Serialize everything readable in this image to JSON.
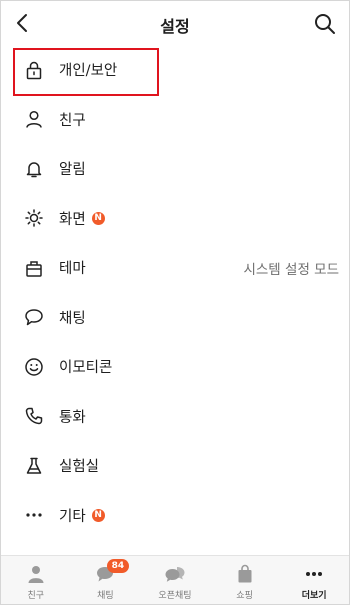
{
  "header": {
    "title": "설정",
    "back_icon": "chevron-left-icon",
    "search_icon": "search-icon"
  },
  "menu": {
    "items": [
      {
        "label": "개인/보안",
        "icon": "lock-icon"
      },
      {
        "label": "친구",
        "icon": "person-icon"
      },
      {
        "label": "알림",
        "icon": "bell-icon"
      },
      {
        "label": "화면",
        "icon": "sun-icon",
        "badge": "N"
      },
      {
        "label": "테마",
        "icon": "theme-icon",
        "value": "시스템 설정 모드"
      },
      {
        "label": "채팅",
        "icon": "chat-bubble-icon"
      },
      {
        "label": "이모티콘",
        "icon": "smile-icon"
      },
      {
        "label": "통화",
        "icon": "phone-icon"
      },
      {
        "label": "실험실",
        "icon": "flask-icon"
      },
      {
        "label": "기타",
        "icon": "more-icon",
        "badge": "N"
      }
    ],
    "highlight_color": "#e0141e"
  },
  "tabbar": {
    "tabs": [
      {
        "label": "친구",
        "icon": "person-tab-icon"
      },
      {
        "label": "채팅",
        "icon": "chat-tab-icon",
        "badge": "84"
      },
      {
        "label": "오픈채팅",
        "icon": "open-chat-tab-icon"
      },
      {
        "label": "쇼핑",
        "icon": "shopping-bag-icon"
      },
      {
        "label": "더보기",
        "icon": "more-tab-icon",
        "active": true
      }
    ]
  },
  "colors": {
    "badge": "#f15b2a",
    "text": "#1f1f1f",
    "muted": "#6f6f6f"
  }
}
